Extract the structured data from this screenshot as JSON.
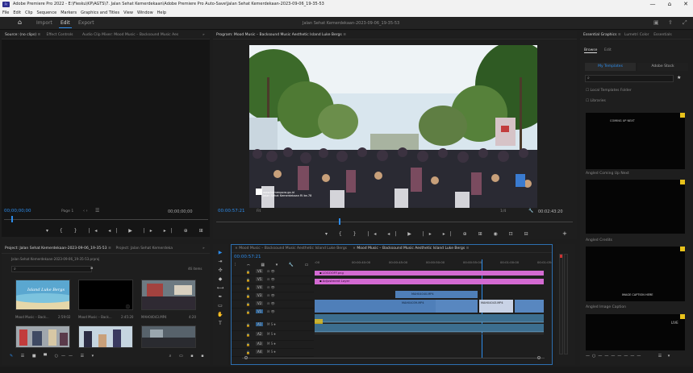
{
  "window": {
    "title": "Adobe Premiere Pro 2022 - E:\\Fiesku\\KP\\AGTS\\7. Jalan Sehat Kemerdekaan\\Adobe Premiere Pro Auto-Save\\Jalan Sehat Kemerdekaan-2023-09-06_19-35-53",
    "minimize": "—",
    "maximize": "⌂",
    "close": "✕"
  },
  "menu": [
    "File",
    "Edit",
    "Clip",
    "Sequence",
    "Markers",
    "Graphics and Titles",
    "View",
    "Window",
    "Help"
  ],
  "app_tabs": {
    "home": "⌂",
    "import": "Import",
    "edit": "Edit",
    "export": "Export"
  },
  "project_title": "Jalan Sehat Kemerdekaan-2023-09-06_19-35-53",
  "source_panel": {
    "tabs": [
      "Source: (no clips)",
      "Effect Controls",
      "Audio Clip Mixer: Mood Music – Backsound Music Aes"
    ],
    "timecode_left": "00;00;00;00",
    "page": "Page 1",
    "timecode_right": "00;00;00;00"
  },
  "program_panel": {
    "tab": "Program: Mood Music – Backsound Music Aesthetic Island Luke Bergs",
    "timecode": "00:00:57:21",
    "fit": "Fit",
    "resolution": "1/4",
    "duration": "00:02:43:20",
    "watermark_line1": "www.kemenpora.go.id",
    "watermark_line2": "Jalan Sehat Kemerdekaan RI ke-78"
  },
  "project_panel": {
    "tabs": [
      "Project: Jalan Sehat Kemerdekaan-2023-09-06_19-35-53",
      "Project: Jalan Sehat Kemerdeka"
    ],
    "path": "Jalan Sehat Kemerdekaan-2023-09-06_19-35-53.prproj",
    "item_count": "46 items",
    "items": [
      {
        "name": "Mood Music – Back...",
        "duration": "2:59:02"
      },
      {
        "name": "Mood Music – Back...",
        "duration": "2:45:20"
      },
      {
        "name": "MAH04043.MP4",
        "duration": "4:20"
      }
    ],
    "thumb_text": "Island Luke Bergs"
  },
  "timeline": {
    "tabs": [
      "Mood Music – Backsound Music Aesthetic Island Luke Bergs",
      "Mood Music – Backsound Music Aesthetic Island Luke Bergs"
    ],
    "timecode": "00:00:57:21",
    "ruler": [
      ":00",
      "00:00:40:00",
      "00:00:45:00",
      "00:00:50:00",
      "00:00:55:00",
      "00:01:00:00",
      "00:01:05:"
    ],
    "video_tracks": [
      "V6",
      "V5",
      "V4",
      "V3",
      "V2",
      "V1"
    ],
    "audio_tracks": [
      "A1",
      "A2",
      "A3",
      "A4"
    ],
    "track_label_m": "M",
    "track_label_s": "S",
    "clips": {
      "logo": "LOGOOFF.png",
      "adjustment": "Adjustment Layer",
      "v2_clip": "MAH04040.MP4",
      "v1_clip": "MAH04039.MP4",
      "v1_clip2": "MAH04043.MP4"
    }
  },
  "essential_graphics": {
    "tabs": [
      "Essential Graphics",
      "Lumetri Color",
      "Essentials"
    ],
    "subtabs": [
      "Browse",
      "Edit"
    ],
    "source_tabs": [
      "My Templates",
      "Adobe Stock"
    ],
    "checkboxes": [
      "Local Templates Folder",
      "Libraries"
    ],
    "templates": [
      {
        "name": "Angled Coming Up Next",
        "preview": "COMING UP NEXT"
      },
      {
        "name": "Angled Credits",
        "preview": ""
      },
      {
        "name": "Angled Image Caption",
        "preview": "IMAGE CAPTION HERE"
      },
      {
        "name": "",
        "preview": "LIVE"
      }
    ]
  },
  "colors": {
    "accent": "#2d8ceb",
    "pink_clip": "#d36ad2",
    "video_clip": "#4f7fb9",
    "audio_clip": "#3c6e8f",
    "fx_badge": "#e8c21b"
  }
}
